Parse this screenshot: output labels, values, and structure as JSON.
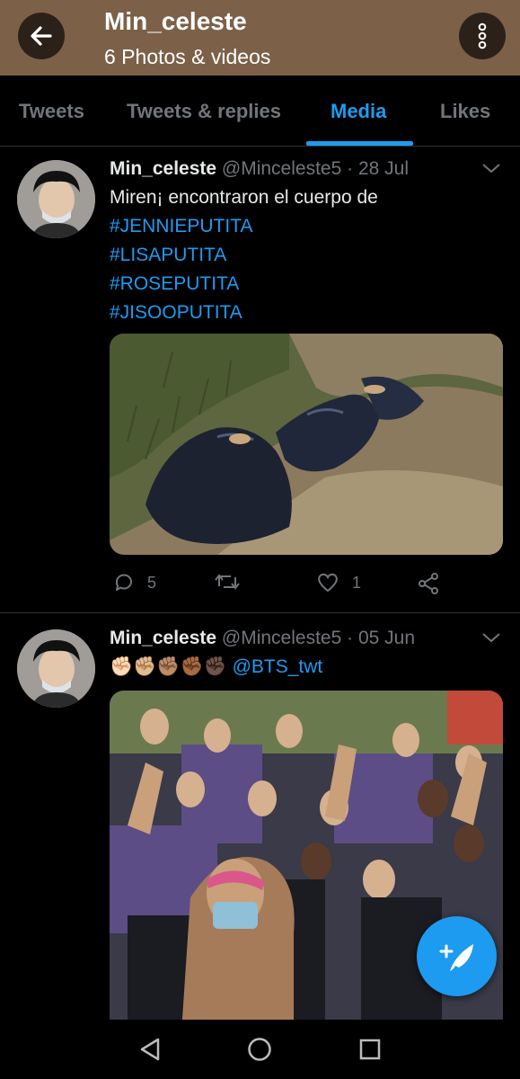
{
  "header": {
    "title": "Min_celeste",
    "subtitle": "6 Photos & videos"
  },
  "tabs": [
    {
      "label": "Tweets"
    },
    {
      "label": "Tweets & replies"
    },
    {
      "label": "Media",
      "active": true
    },
    {
      "label": "Likes"
    }
  ],
  "tweets": [
    {
      "name": "Min_celeste",
      "meta": "@Minceleste5 · 28 Jul",
      "text": "Miren¡ encontraron el cuerpo de",
      "hashtags": [
        "#JENNIEPUTITA",
        "#LISAPUTITA",
        "#ROSEPUTITA",
        "#JISOOPUTITA"
      ],
      "replies": "5",
      "retweets": "",
      "likes": "1"
    },
    {
      "name": "Min_celeste",
      "meta": "@Minceleste5 · 05 Jun",
      "emoji": "✊🏻✊🏼✊🏽✊🏾✊🏿",
      "mention": "@BTS_twt"
    }
  ],
  "colors": {
    "accent": "#1d9bf0",
    "header_bg": "#7c6048",
    "muted": "#71767b"
  },
  "icons": {
    "back": "arrow-left-icon",
    "more": "vertical-dots-icon",
    "reply": "speech-bubble-icon",
    "retweet": "retweet-icon",
    "like": "heart-icon",
    "share": "share-icon",
    "compose": "feather-plus-icon",
    "caret": "chevron-down-icon"
  }
}
